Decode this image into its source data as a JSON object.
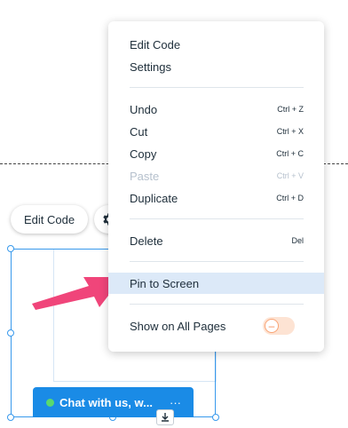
{
  "canvas": {
    "edit_code_label": "Edit Code",
    "help_label": "?",
    "gear_icon": "gear-icon",
    "chat_widget": {
      "label": "Chat with us, w...",
      "more": "···",
      "status_color": "#59d96e",
      "background": "#1a8be6"
    },
    "selection_color": "#3899ec",
    "arrow_color": "#f0457a"
  },
  "context_menu": {
    "items": [
      {
        "label": "Edit Code",
        "shortcut": ""
      },
      {
        "label": "Settings",
        "shortcut": ""
      },
      {
        "label": "Undo",
        "shortcut": "Ctrl + Z"
      },
      {
        "label": "Cut",
        "shortcut": "Ctrl + X"
      },
      {
        "label": "Copy",
        "shortcut": "Ctrl + C"
      },
      {
        "label": "Paste",
        "shortcut": "Ctrl + V",
        "disabled": true
      },
      {
        "label": "Duplicate",
        "shortcut": "Ctrl + D"
      },
      {
        "label": "Delete",
        "shortcut": "Del"
      },
      {
        "label": "Pin to Screen",
        "shortcut": "",
        "highlighted": true
      },
      {
        "label": "Show on All Pages",
        "shortcut": ""
      }
    ],
    "toggle": {
      "state": "off",
      "symbol": "–",
      "color": "#f58a53"
    }
  }
}
